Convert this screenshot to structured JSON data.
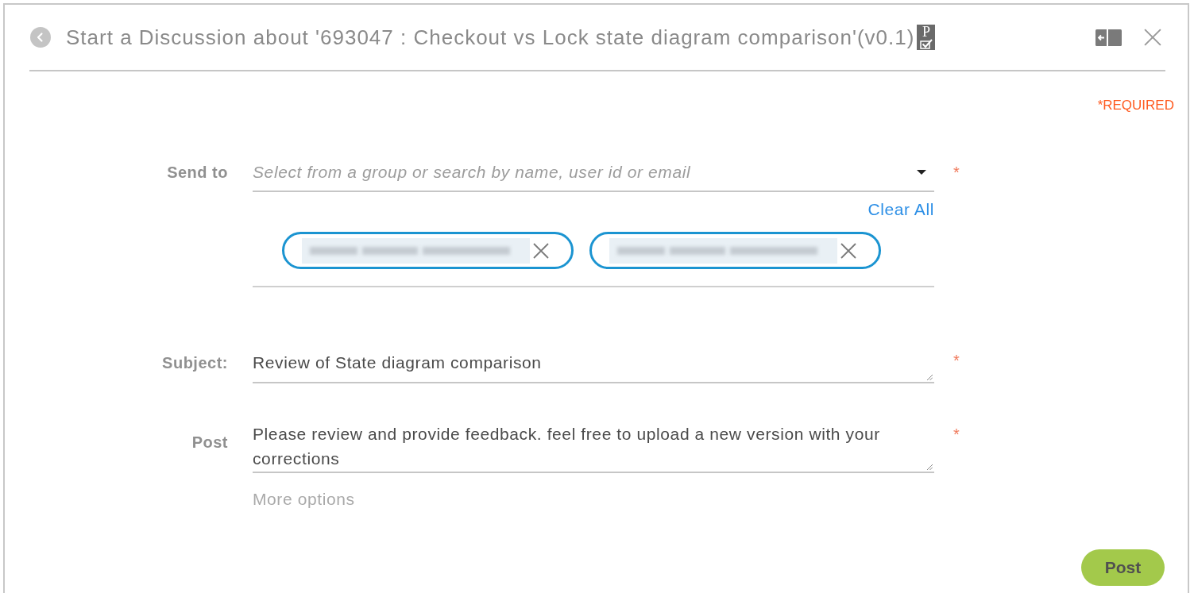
{
  "dialog": {
    "title": "Start a Discussion about '693047 : Checkout vs Lock state diagram comparison'(v0.1)",
    "title_badge": "P",
    "required_note": "*REQUIRED"
  },
  "send_to": {
    "label": "Send to",
    "placeholder": "Select from a group or search by name, user id or email",
    "required_mark": "*",
    "clear_all": "Clear All",
    "recipients": [
      {
        "kind": "redacted"
      },
      {
        "kind": "redacted"
      }
    ]
  },
  "subject": {
    "label": "Subject:",
    "value": "Review of State diagram comparison",
    "required_mark": "*"
  },
  "post": {
    "label": "Post",
    "value": "Please review and provide feedback. feel free to upload a new version with your corrections",
    "required_mark": "*"
  },
  "more_options": "More options",
  "buttons": [
    {
      "label": "Post",
      "kind": "primary"
    }
  ]
}
